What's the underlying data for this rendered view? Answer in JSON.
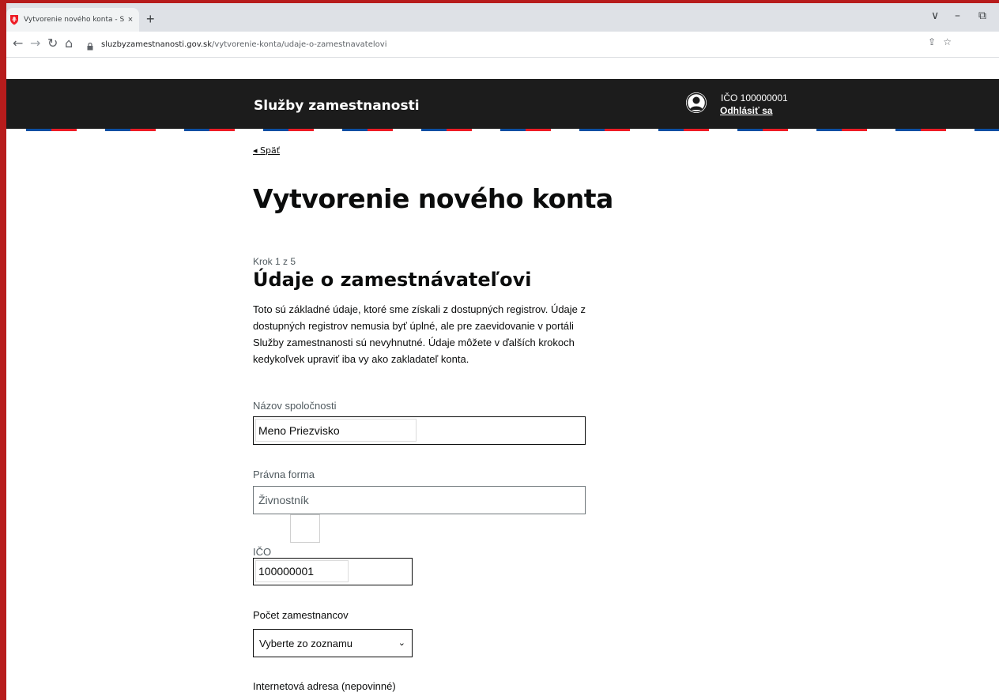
{
  "browser": {
    "tab_title": "Vytvorenie nového konta - Služb",
    "tab_close": "×",
    "new_tab": "+",
    "url_host": "sluzbyzamestnanosti.gov.sk",
    "url_path": "/vytvorenie-konta/udaje-o-zamestnavatelovi",
    "controls": {
      "dropdown": "∨",
      "minimize": "–",
      "restore": "⧉"
    }
  },
  "header": {
    "brand": "Služby zamestnanosti",
    "user_ico": "IČO 100000001",
    "logout": "Odhlásiť sa"
  },
  "page": {
    "back": "Späť",
    "title": "Vytvorenie nového konta",
    "step": "Krok 1 z 5",
    "section_title": "Údaje o zamestnávateľovi",
    "intro": "Toto sú základné údaje, ktoré sme získali z dostupných registrov. Údaje z dostupných registrov nemusia byť úplné, ale pre zaevidovanie v portáli Služby zamestnanosti sú nevyhnutné. Údaje môžete v ďalších krokoch kedykoľvek upraviť iba vy ako zakladateľ konta."
  },
  "form": {
    "company_name": {
      "label": "Názov spoločnosti",
      "value": "Meno Priezvisko"
    },
    "legal_form": {
      "label": "Právna forma",
      "value": "Živnostník"
    },
    "ico": {
      "label": "IČO",
      "value": "100000001"
    },
    "employees": {
      "label": "Počet zamestnancov",
      "selected": "Vyberte zo zoznamu"
    },
    "website": {
      "label": "Internetová adresa (nepovinné)"
    }
  },
  "colors": {
    "header_bg": "#1c1c1c",
    "flag_blue": "#0b4ea2",
    "flag_red": "#ee1c25",
    "frame": "#b71c1c"
  }
}
